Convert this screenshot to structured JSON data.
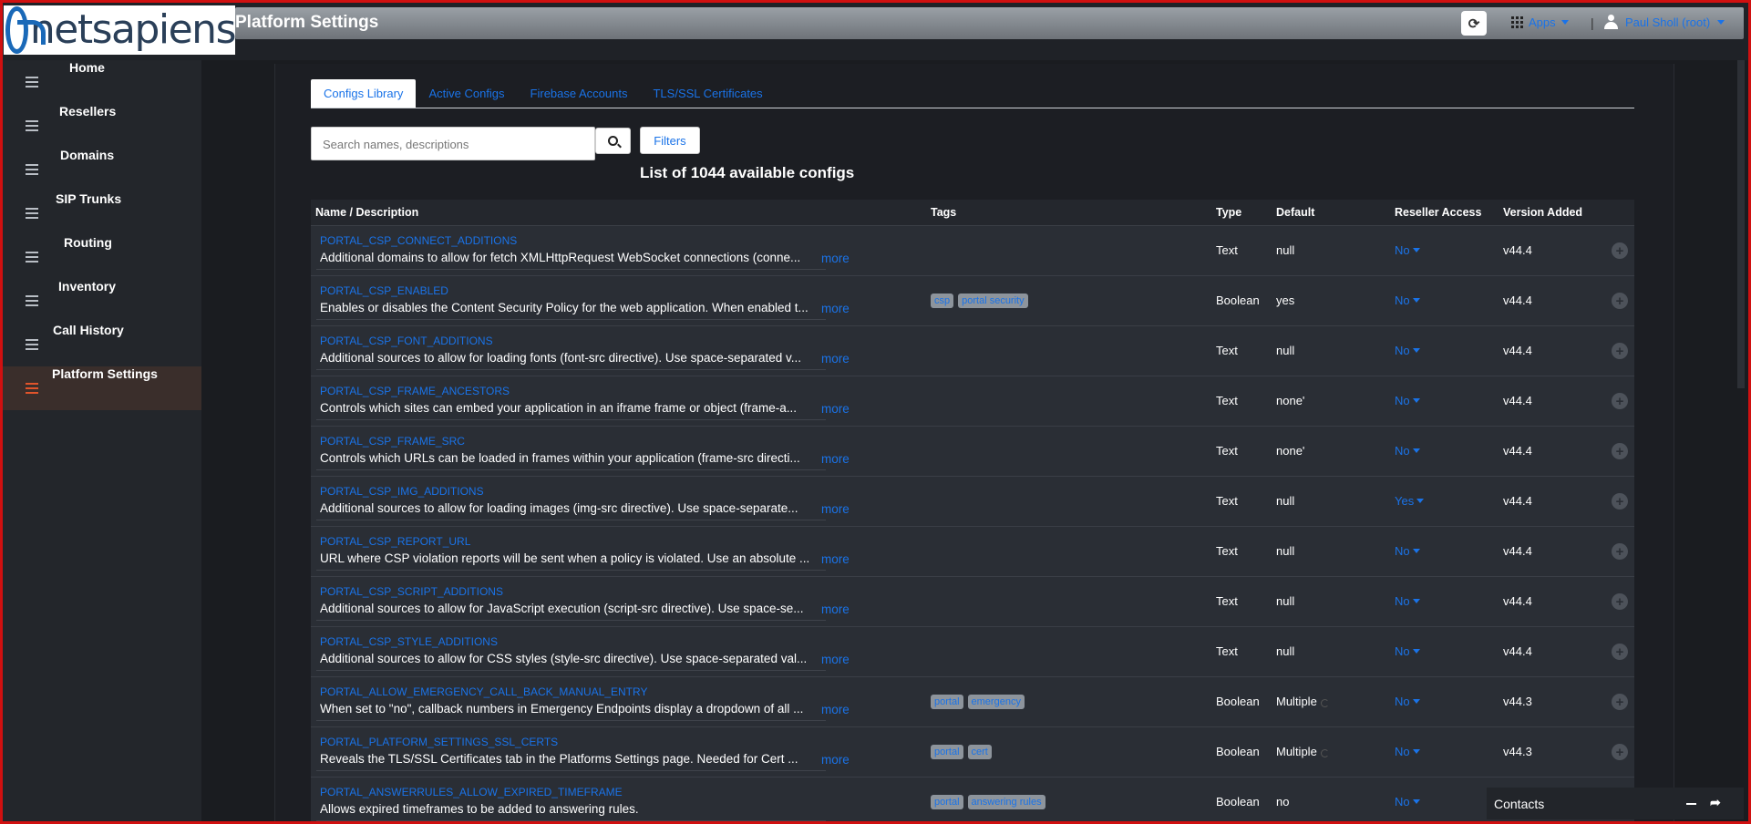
{
  "header": {
    "logo_text": "netsapiens",
    "page_title": "Platform Settings",
    "apps_label": "Apps",
    "user_label": "Paul Sholl (root)"
  },
  "sidebar": {
    "items": [
      {
        "label": "Home"
      },
      {
        "label": "Resellers"
      },
      {
        "label": "Domains"
      },
      {
        "label": "SIP Trunks"
      },
      {
        "label": "Routing"
      },
      {
        "label": "Inventory"
      },
      {
        "label": "Call History"
      },
      {
        "label": "Platform Settings"
      }
    ]
  },
  "tabs": [
    {
      "label": "Configs Library",
      "active": true
    },
    {
      "label": "Active Configs"
    },
    {
      "label": "Firebase Accounts"
    },
    {
      "label": "TLS/SSL Certificates"
    }
  ],
  "search": {
    "placeholder": "Search names, descriptions"
  },
  "filters_label": "Filters",
  "list_count": "List of 1044 available configs",
  "table": {
    "headers": [
      "Name / Description",
      "Tags",
      "Type",
      "Default",
      "Reseller Access",
      "Version Added"
    ],
    "more_label": "more",
    "rows": [
      {
        "name": "PORTAL_CSP_CONNECT_ADDITIONS",
        "desc": "Additional domains to allow for fetch XMLHttpRequest WebSocket connections (conne...",
        "tags": [],
        "type": "Text",
        "default": "null",
        "access": "No",
        "version": "v44.4"
      },
      {
        "name": "PORTAL_CSP_ENABLED",
        "desc": "Enables or disables the Content Security Policy for the web application. When enabled t...",
        "tags": [
          "csp",
          "portal security"
        ],
        "type": "Boolean",
        "default": "yes",
        "access": "No",
        "version": "v44.4"
      },
      {
        "name": "PORTAL_CSP_FONT_ADDITIONS",
        "desc": "Additional sources to allow for loading fonts (font-src directive). Use space-separated v...",
        "tags": [],
        "type": "Text",
        "default": "null",
        "access": "No",
        "version": "v44.4"
      },
      {
        "name": "PORTAL_CSP_FRAME_ANCESTORS",
        "desc": "Controls which sites can embed your application in an iframe frame or object (frame-a...",
        "tags": [],
        "type": "Text",
        "default": "none'",
        "access": "No",
        "version": "v44.4"
      },
      {
        "name": "PORTAL_CSP_FRAME_SRC",
        "desc": "Controls which URLs can be loaded in frames within your application (frame-src directi...",
        "tags": [],
        "type": "Text",
        "default": "none'",
        "access": "No",
        "version": "v44.4"
      },
      {
        "name": "PORTAL_CSP_IMG_ADDITIONS",
        "desc": "Additional sources to allow for loading images (img-src directive). Use space-separate...",
        "tags": [],
        "type": "Text",
        "default": "null",
        "access": "Yes",
        "version": "v44.4"
      },
      {
        "name": "PORTAL_CSP_REPORT_URL",
        "desc": "URL where CSP violation reports will be sent when a policy is violated. Use an absolute ...",
        "tags": [],
        "type": "Text",
        "default": "null",
        "access": "No",
        "version": "v44.4"
      },
      {
        "name": "PORTAL_CSP_SCRIPT_ADDITIONS",
        "desc": "Additional sources to allow for JavaScript execution (script-src directive). Use space-se...",
        "tags": [],
        "type": "Text",
        "default": "null",
        "access": "No",
        "version": "v44.4"
      },
      {
        "name": "PORTAL_CSP_STYLE_ADDITIONS",
        "desc": "Additional sources to allow for CSS styles (style-src directive). Use space-separated val...",
        "tags": [],
        "type": "Text",
        "default": "null",
        "access": "No",
        "version": "v44.4"
      },
      {
        "name": "PORTAL_ALLOW_EMERGENCY_CALL_BACK_MANUAL_ENTRY",
        "desc": "When set to \"no\", callback numbers in Emergency Endpoints display a dropdown of all ...",
        "tags": [
          "portal",
          "emergency"
        ],
        "type": "Boolean",
        "default": "Multiple",
        "spinner": true,
        "access": "No",
        "version": "v44.3"
      },
      {
        "name": "PORTAL_PLATFORM_SETTINGS_SSL_CERTS",
        "desc": "Reveals the TLS/SSL Certificates tab in the Platforms Settings page. Needed for Cert ...",
        "tags": [
          "portal",
          "cert"
        ],
        "type": "Boolean",
        "default": "Multiple",
        "spinner": true,
        "access": "No",
        "version": "v44.3"
      },
      {
        "name": "PORTAL_ANSWERRULES_ALLOW_EXPIRED_TIMEFRAME",
        "desc": "Allows expired timeframes to be added to answering rules.",
        "tags": [
          "portal",
          "answering rules"
        ],
        "type": "Boolean",
        "default": "no",
        "access": "No",
        "version": "",
        "no_more": true
      }
    ]
  },
  "contacts_label": "Contacts",
  "colors": {
    "accent": "#1a73e8",
    "active_nav": "#e0542b",
    "tag_bg": "#8d949c"
  }
}
